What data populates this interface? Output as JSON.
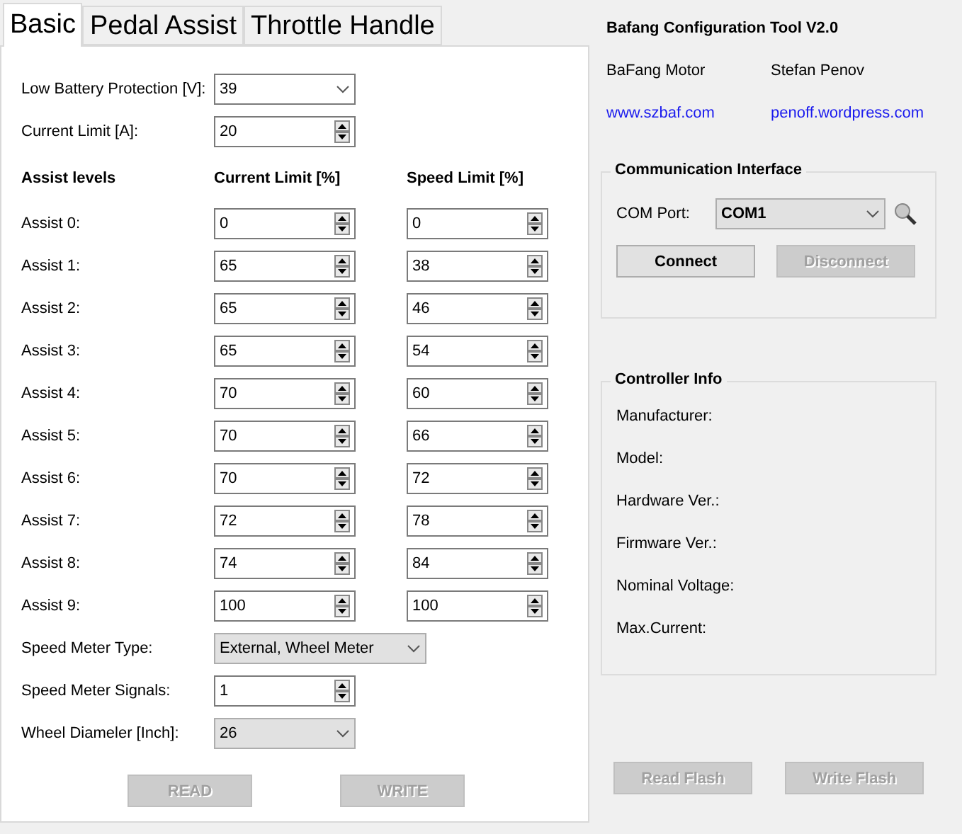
{
  "tabs": [
    {
      "label": "Basic",
      "selected": true
    },
    {
      "label": "Pedal Assist",
      "selected": false
    },
    {
      "label": "Throttle Handle",
      "selected": false
    }
  ],
  "top_fields": [
    {
      "kind": "dropdown",
      "label": "Low Battery Protection [V]:",
      "value": "39",
      "disabled": false
    },
    {
      "kind": "spin",
      "label": "Current Limit [A]:",
      "value": "20"
    }
  ],
  "assist_table": {
    "columns": [
      "Assist levels",
      "Current Limit [%]",
      "Speed Limit [%]"
    ],
    "rows": [
      {
        "label": "Assist 0:",
        "current": "0",
        "speed": "0"
      },
      {
        "label": "Assist 1:",
        "current": "65",
        "speed": "38"
      },
      {
        "label": "Assist 2:",
        "current": "65",
        "speed": "46"
      },
      {
        "label": "Assist 3:",
        "current": "65",
        "speed": "54"
      },
      {
        "label": "Assist 4:",
        "current": "70",
        "speed": "60"
      },
      {
        "label": "Assist 5:",
        "current": "70",
        "speed": "66"
      },
      {
        "label": "Assist 6:",
        "current": "70",
        "speed": "72"
      },
      {
        "label": "Assist 7:",
        "current": "72",
        "speed": "78"
      },
      {
        "label": "Assist 8:",
        "current": "74",
        "speed": "84"
      },
      {
        "label": "Assist 9:",
        "current": "100",
        "speed": "100"
      }
    ]
  },
  "bottom_fields": [
    {
      "kind": "dropdown",
      "label": "Speed Meter Type:",
      "value": "External, Wheel Meter",
      "disabled": true,
      "wide": true
    },
    {
      "kind": "spin",
      "label": "Speed Meter Signals:",
      "value": "1"
    },
    {
      "kind": "dropdown",
      "label": "Wheel Diameler [Inch]:",
      "value": "26",
      "disabled": true
    }
  ],
  "left_buttons": [
    {
      "label": "READ",
      "disabled": true
    },
    {
      "label": "WRITE",
      "disabled": true
    }
  ],
  "about": {
    "title": "Bafang Configuration Tool V2.0",
    "names": [
      "BaFang Motor",
      "Stefan Penov"
    ],
    "links": [
      "www.szbaf.com",
      "penoff.wordpress.com"
    ]
  },
  "communication": {
    "title": "Communication Interface",
    "port_label": "COM Port:",
    "port": "COM1",
    "buttons": [
      {
        "label": "Connect",
        "disabled": false
      },
      {
        "label": "Disconnect",
        "disabled": true
      }
    ]
  },
  "controller_info": {
    "title": "Controller Info",
    "fields": [
      "Manufacturer:",
      "Model:",
      "Hardware Ver.:",
      "Firmware Ver.:",
      "Nominal Voltage:",
      "Max.Current:"
    ]
  },
  "right_buttons": [
    {
      "label": "Read Flash",
      "disabled": true
    },
    {
      "label": "Write Flash",
      "disabled": true
    }
  ]
}
